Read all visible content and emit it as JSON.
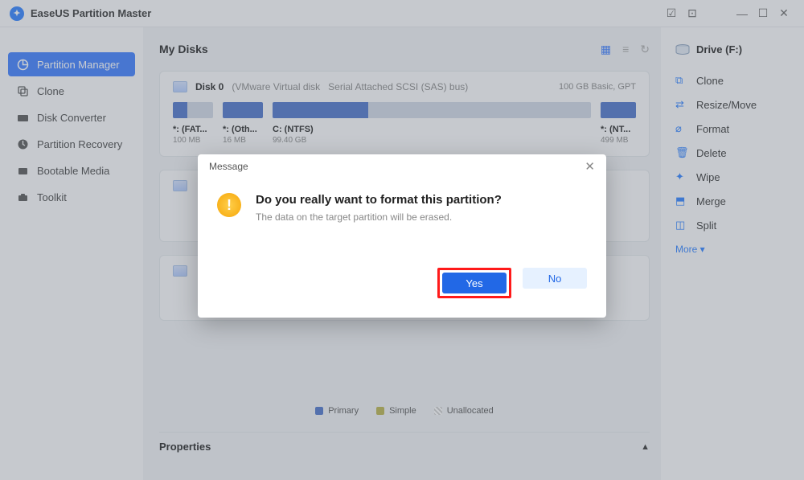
{
  "titlebar": {
    "app_name": "EaseUS Partition Master"
  },
  "sidebar": {
    "items": [
      {
        "label": "Partition Manager"
      },
      {
        "label": "Clone"
      },
      {
        "label": "Disk Converter"
      },
      {
        "label": "Partition Recovery"
      },
      {
        "label": "Bootable Media"
      },
      {
        "label": "Toolkit"
      }
    ]
  },
  "main": {
    "heading": "My Disks",
    "disk0": {
      "name": "Disk 0",
      "vendor": "(VMware   Virtual disk",
      "bus": "Serial Attached SCSI (SAS) bus)",
      "summary": "100 GB Basic, GPT",
      "parts": [
        {
          "label": "*: (FAT...",
          "size": "100 MB"
        },
        {
          "label": "*: (Oth...",
          "size": "16 MB"
        },
        {
          "label": "C: (NTFS)",
          "size": "99.40 GB"
        },
        {
          "label": "*: (NT...",
          "size": "499 MB"
        }
      ]
    },
    "legend": {
      "primary": "Primary",
      "simple": "Simple",
      "unallocated": "Unallocated"
    },
    "properties": "Properties"
  },
  "right": {
    "drive": "Drive (F:)",
    "actions": [
      {
        "label": "Clone"
      },
      {
        "label": "Resize/Move"
      },
      {
        "label": "Format"
      },
      {
        "label": "Delete"
      },
      {
        "label": "Wipe"
      },
      {
        "label": "Merge"
      },
      {
        "label": "Split"
      }
    ],
    "more": "More  ▾"
  },
  "dialog": {
    "title": "Message",
    "question": "Do you really want to format this partition?",
    "message": "The data on the target partition will be erased.",
    "yes": "Yes",
    "no": "No"
  }
}
